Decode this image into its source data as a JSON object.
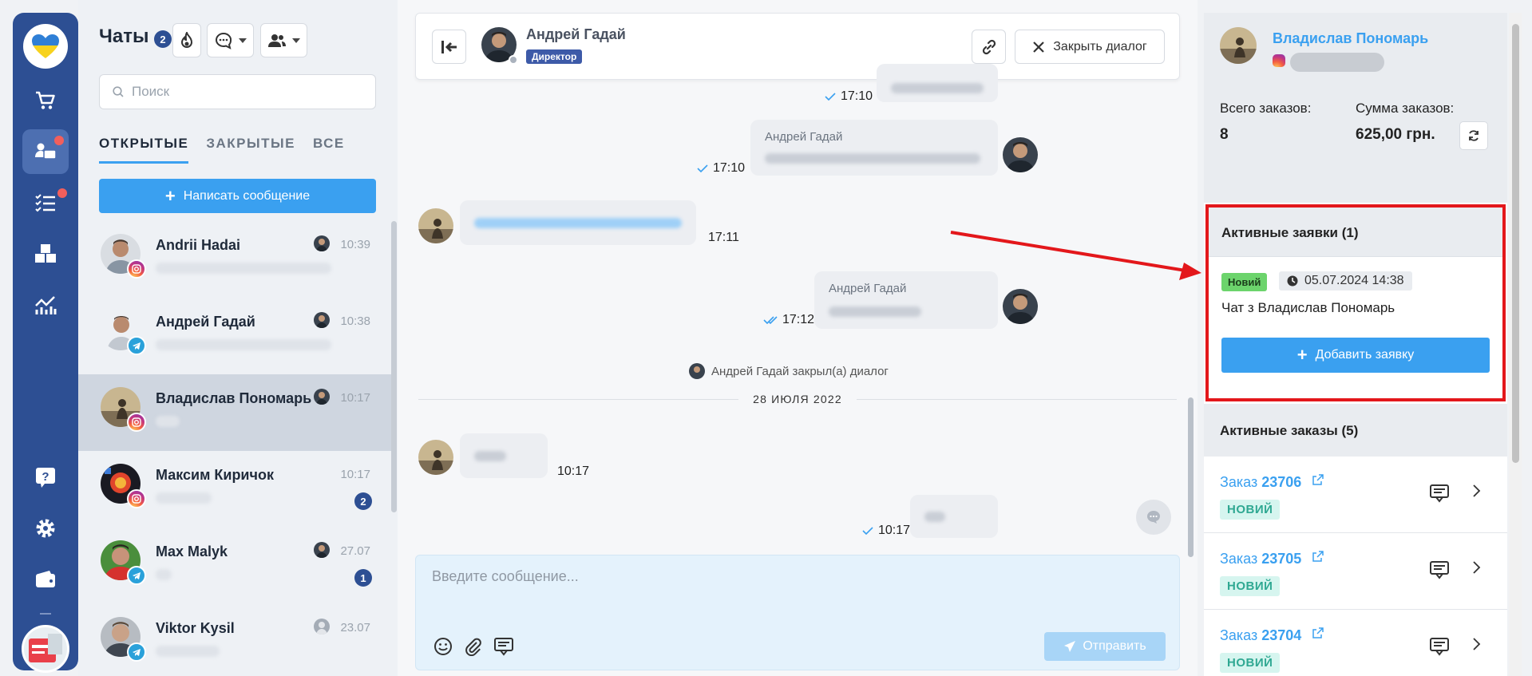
{
  "colors": {
    "brand": "#2d4f93",
    "accent": "#3aa0f0",
    "highlight": "#e3171b"
  },
  "sidebar": {
    "items": [
      {
        "name": "cart-icon"
      },
      {
        "name": "chats-icon",
        "active": true,
        "notification": true
      },
      {
        "name": "tasks-icon",
        "notification": true
      },
      {
        "name": "warehouse-icon"
      },
      {
        "name": "analytics-icon"
      },
      {
        "name": "help-icon"
      },
      {
        "name": "settings-icon"
      },
      {
        "name": "wallet-icon"
      }
    ]
  },
  "chat_list": {
    "title": "Чаты",
    "count": "2",
    "search_placeholder": "Поиск",
    "tabs": [
      "ОТКРЫТЫЕ",
      "ЗАКРЫТЫЕ",
      "ВСЕ"
    ],
    "compose_label": "Написать сообщение",
    "items": [
      {
        "name": "Andrii Hadai",
        "time": "10:39",
        "source": "instagram",
        "unread": ""
      },
      {
        "name": "Андрей Гадай",
        "time": "10:38",
        "source": "telegram",
        "unread": ""
      },
      {
        "name": "Владислав Пономарь",
        "time": "10:17",
        "source": "instagram",
        "unread": "",
        "selected": true
      },
      {
        "name": "Максим Киричок",
        "time": "10:17",
        "source": "instagram",
        "unread": "2"
      },
      {
        "name": "Max Malyk",
        "time": "27.07",
        "source": "telegram",
        "unread": "1"
      },
      {
        "name": "Viktor Kysil",
        "time": "23.07",
        "source": "telegram",
        "unread": ""
      }
    ]
  },
  "conversation": {
    "contact_name": "Андрей Гадай",
    "contact_role": "Директор",
    "close_label": "Закрыть диалог",
    "messages": [
      {
        "time": "17:10"
      },
      {
        "sender": "Андрей Гадай",
        "time": "17:10"
      },
      {
        "time": "17:11"
      },
      {
        "sender": "Андрей Гадай",
        "time": "17:12"
      },
      {
        "time": "10:17"
      },
      {
        "time": "10:17"
      }
    ],
    "system_message": "Андрей Гадай закрыл(а) диалог",
    "date_separator": "28 ИЮЛЯ 2022",
    "input_placeholder": "Введите сообщение...",
    "send_label": "Отправить"
  },
  "customer": {
    "name": "Владислав Пономарь",
    "total_orders_label": "Всего заказов:",
    "total_orders": "8",
    "orders_sum_label": "Сумма заказов:",
    "orders_sum": "625,00 грн.",
    "requests_title": "Активные заявки (1)",
    "request": {
      "status": "Новий",
      "date": "05.07.2024 14:38",
      "text": "Чат з Владислав Пономарь"
    },
    "add_request_label": "Добавить заявку",
    "orders_title": "Активные заказы (5)",
    "orders": [
      {
        "label": "Заказ",
        "number": "23706",
        "status": "НОВИЙ"
      },
      {
        "label": "Заказ",
        "number": "23705",
        "status": "НОВИЙ"
      },
      {
        "label": "Заказ",
        "number": "23704",
        "status": "НОВИЙ"
      }
    ]
  }
}
